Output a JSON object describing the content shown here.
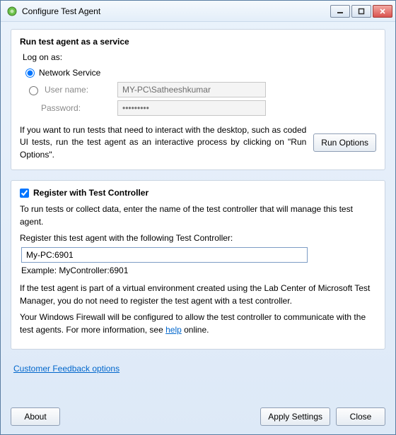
{
  "window": {
    "title": "Configure Test Agent"
  },
  "service_group": {
    "title": "Run test agent as a service",
    "logon_label": "Log on as:",
    "network_service_label": "Network Service",
    "username_label": "User name:",
    "username_value": "MY-PC\\Satheeshkumar",
    "password_label": "Password:",
    "password_value": "•••••••••",
    "desc": "If you want to run tests that need to interact with the desktop, such as coded UI tests, run the test agent as an interactive process by clicking on \"Run Options\".",
    "run_options_btn": "Run Options"
  },
  "register_group": {
    "title": "Register with Test Controller",
    "intro": "To run tests or collect data, enter the name of the test controller that will manage this test agent.",
    "register_label": "Register this test agent with the following Test Controller:",
    "controller_value": "My-PC:6901",
    "example": "Example: MyController:6901",
    "virtual_env": "If the test agent is part of a virtual environment created using the Lab Center of Microsoft Test Manager, you do not need to register the test agent with a test controller.",
    "firewall_prefix": "Your Windows Firewall will be configured to allow the test controller to communicate with the test agents. For more information, see ",
    "help_link": "help",
    "firewall_suffix": " online."
  },
  "feedback_link": "Customer Feedback options",
  "footer": {
    "about": "About",
    "apply": "Apply Settings",
    "close": "Close"
  }
}
